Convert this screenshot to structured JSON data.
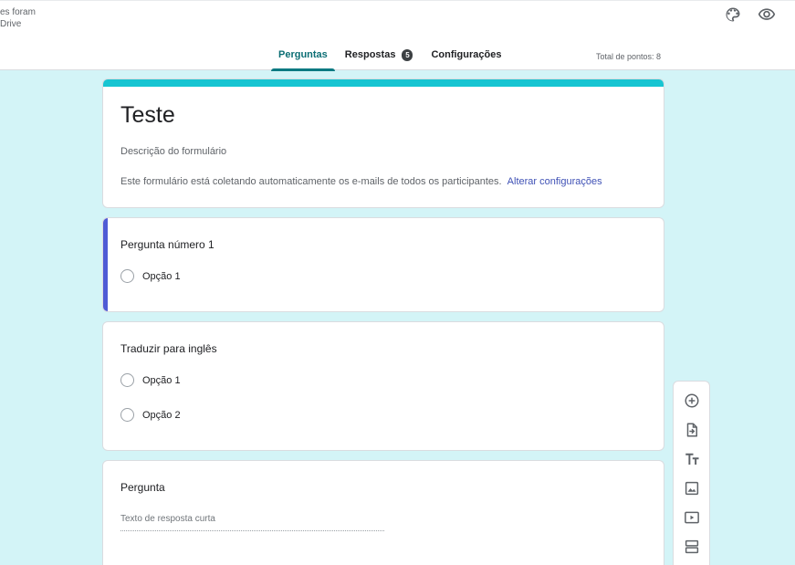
{
  "header": {
    "saved_line1": "es foram",
    "saved_line2": "Drive",
    "icons": [
      "palette-icon",
      "eye-icon"
    ],
    "tabs": [
      {
        "label": "Perguntas",
        "active": true
      },
      {
        "label": "Respostas",
        "badge": "5"
      },
      {
        "label": "Configurações"
      }
    ],
    "total_points": "Total de pontos: 8"
  },
  "form": {
    "title": "Teste",
    "description": "Descrição do formulário",
    "email_note": "Este formulário está coletando automaticamente os e-mails de todos os participantes.",
    "email_link": "Alterar configurações"
  },
  "questions": [
    {
      "title": "Pergunta número 1",
      "options": [
        "Opção 1"
      ]
    },
    {
      "title": "Traduzir para inglês",
      "options": [
        "Opção 1",
        "Opção 2"
      ]
    },
    {
      "title": "Pergunta",
      "short_answer_placeholder": "Texto de resposta curta"
    }
  ],
  "toolbar": {
    "icons": [
      "add-question-icon",
      "import-questions-icon",
      "add-title-icon",
      "add-image-icon",
      "add-video-icon",
      "add-section-icon"
    ]
  },
  "colors": {
    "accent": "#17c5d2",
    "background": "#d3f4f7",
    "active_tab": "#0b7a82",
    "focus_bar": "#4f5bd5",
    "link": "#3f51b5"
  }
}
